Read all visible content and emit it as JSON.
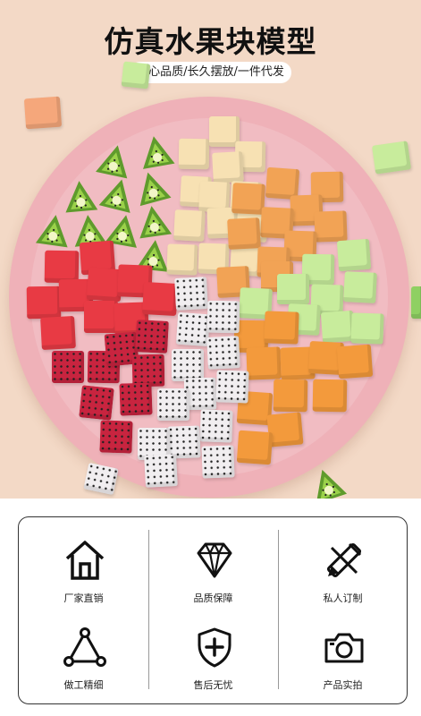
{
  "header": {
    "title": "仿真水果块模型",
    "subtitle": "匠心品质/长久摆放/一件代发"
  },
  "features": [
    {
      "label": "厂家直销",
      "icon": "house-icon"
    },
    {
      "label": "品质保障",
      "icon": "diamond-icon"
    },
    {
      "label": "私人订制",
      "icon": "pencil-ruler-icon"
    },
    {
      "label": "做工精细",
      "icon": "triangle-nodes-icon"
    },
    {
      "label": "售后无忧",
      "icon": "shield-plus-icon"
    },
    {
      "label": "产品实拍",
      "icon": "camera-icon"
    }
  ],
  "colors": {
    "background": "#f3d9c6",
    "plate": "#efb1b8",
    "kiwi": "#6aa833",
    "mango": "#f2a355",
    "watermelon": "#e83a44",
    "dragonfruit_red": "#c8243f",
    "dragonfruit_white": "#f1eef0",
    "melon_green": "#c8ec9c",
    "pear": "#f7e1b3",
    "orange_melon": "#f39a3c"
  }
}
